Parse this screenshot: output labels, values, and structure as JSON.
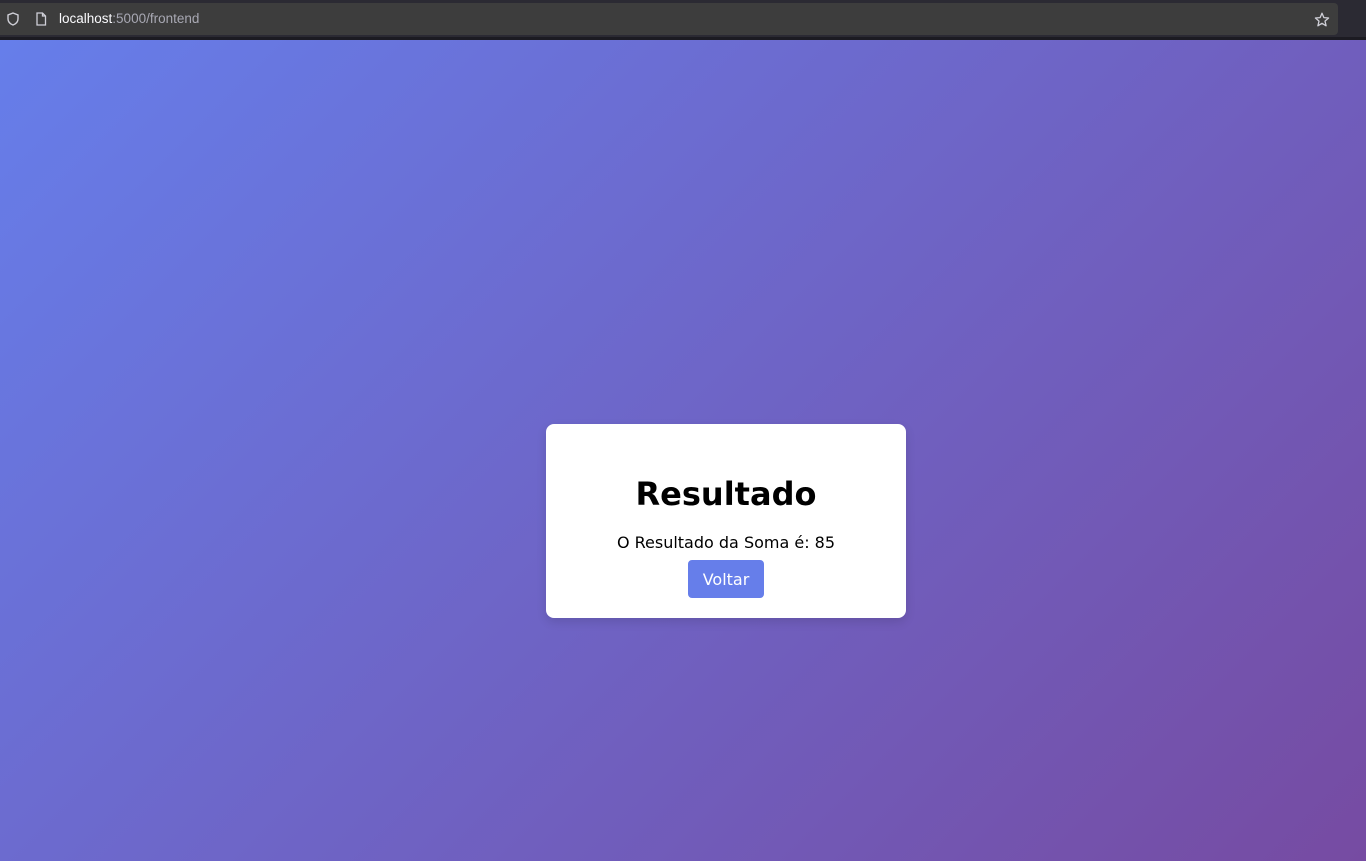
{
  "browser": {
    "url_host": "localhost",
    "url_rest": ":5000/frontend",
    "icons": {
      "shield": "shield-icon",
      "page": "page-icon",
      "bookmark": "star-icon"
    }
  },
  "page": {
    "background_colors": [
      "#667eea",
      "#764ba2"
    ],
    "card": {
      "title": "Resultado",
      "result_text": "O Resultado da Soma é: 85",
      "back_button_label": "Voltar"
    },
    "button_color": "#667eea"
  }
}
